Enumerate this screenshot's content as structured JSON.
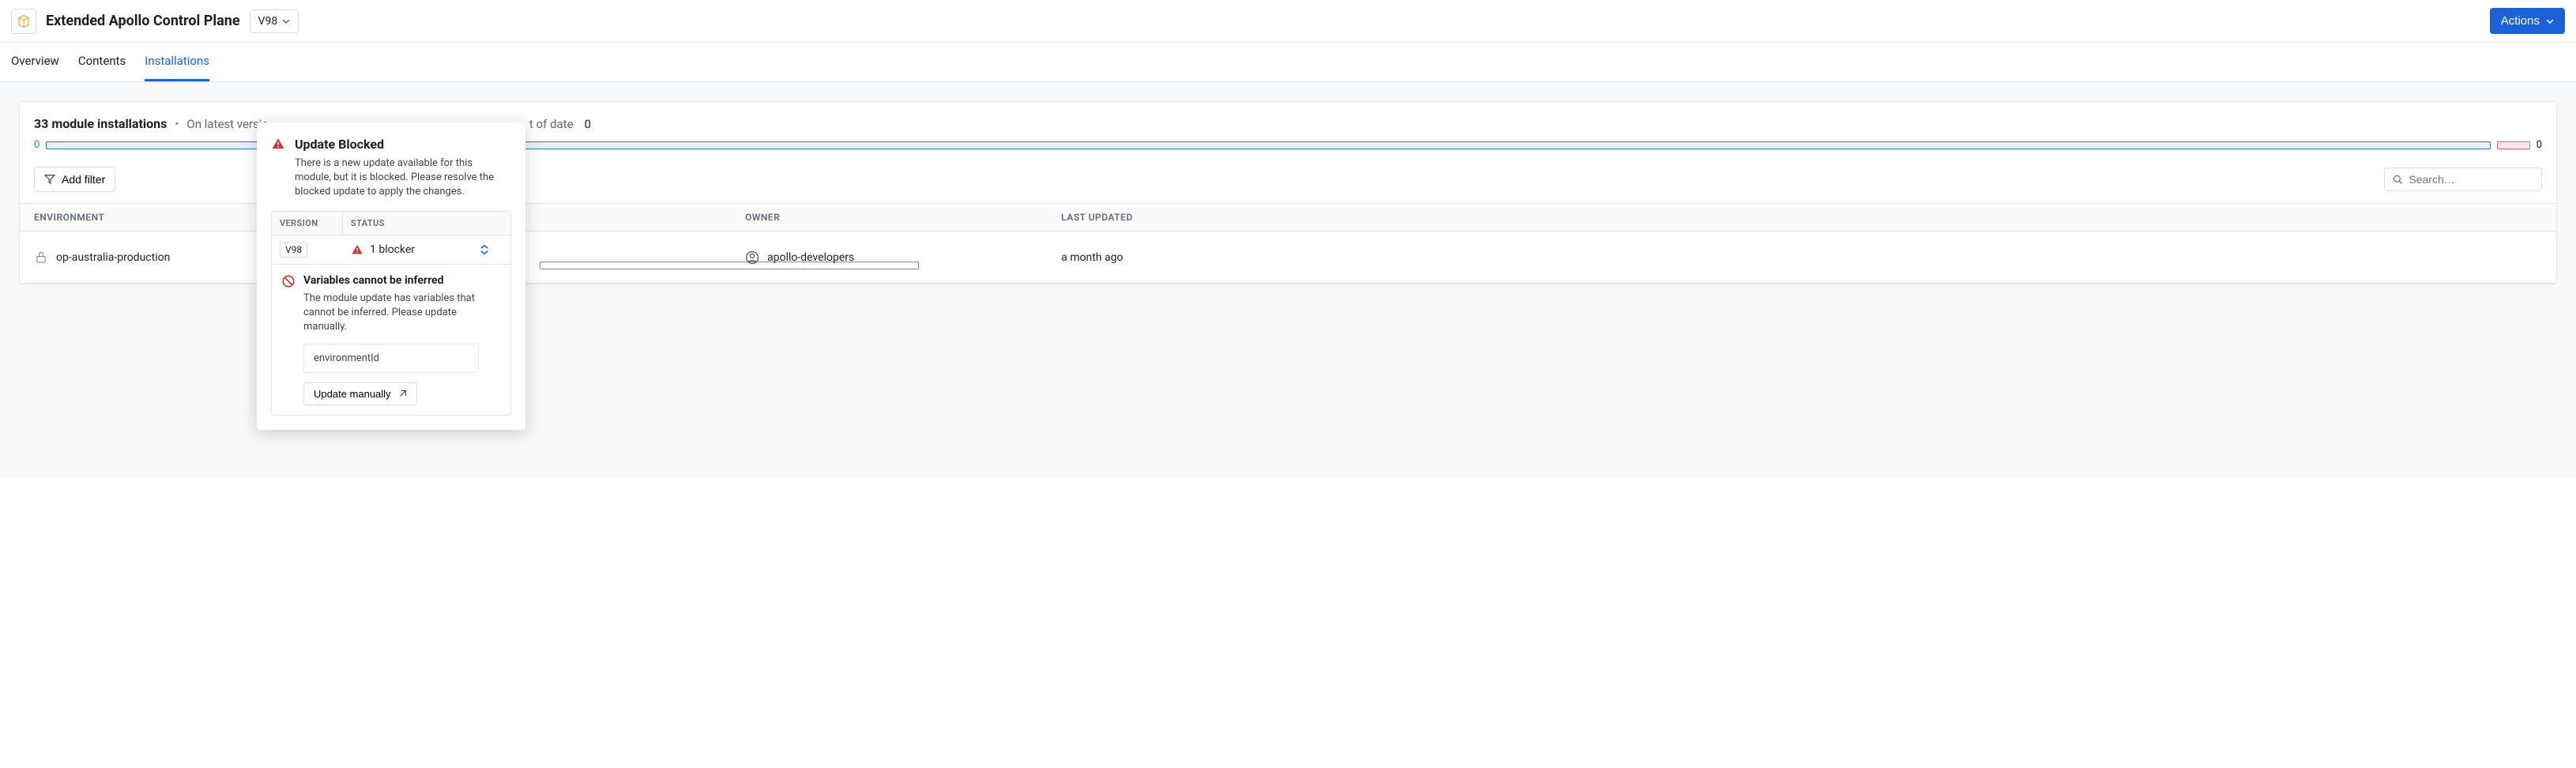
{
  "header": {
    "title": "Extended Apollo Control Plane",
    "version": "V98",
    "actions_label": "Actions"
  },
  "tabs": {
    "overview": "Overview",
    "contents": "Contents",
    "installations": "Installations"
  },
  "summary": {
    "count_text": "33 module installations",
    "latest_label": "On latest versio",
    "outdated_label": "t of date",
    "outdated_value": "0",
    "left_zero": "0",
    "right_zero": "0"
  },
  "toolbar": {
    "add_filter": "Add filter",
    "search_placeholder": "Search…"
  },
  "columns": {
    "environment": "ENVIRONMENT",
    "owner": "OWNER",
    "last_updated": "LAST UPDATED"
  },
  "row": {
    "environment": "op-australia-production",
    "status_tag": "Update Blocked",
    "owner": "apollo-developers",
    "last_updated": "a month ago"
  },
  "popover": {
    "title": "Update Blocked",
    "description": "There is a new update available for this module, but it is blocked. Please resolve the blocked update to apply the changes.",
    "th_version": "VERSION",
    "th_status": "STATUS",
    "row_version": "V98",
    "row_status": "1 blocker",
    "detail_title": "Variables cannot be inferred",
    "detail_desc": "The module update has variables that cannot be inferred. Please update manually.",
    "variable": "environmentId",
    "update_btn": "Update manually"
  }
}
